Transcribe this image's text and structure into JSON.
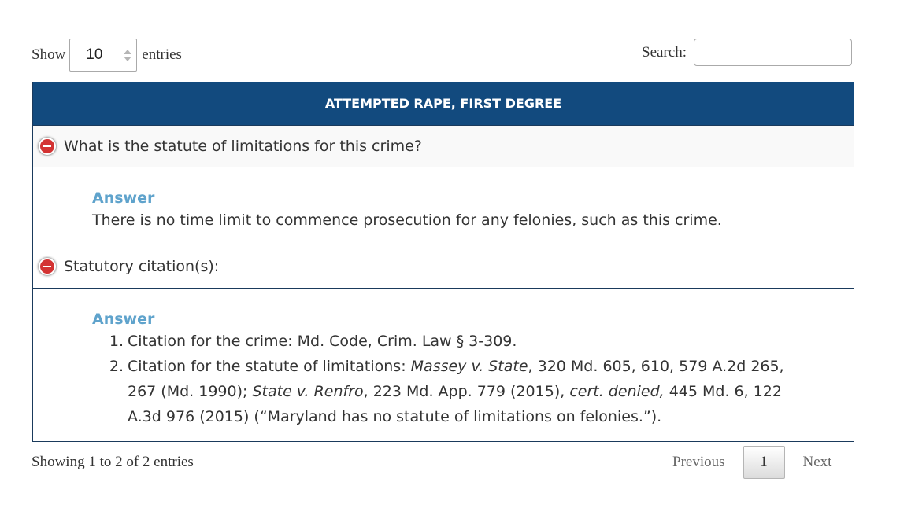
{
  "length_menu": {
    "prefix": "Show",
    "value": "10",
    "suffix": "entries"
  },
  "search": {
    "label": "Search:",
    "value": "",
    "placeholder": ""
  },
  "table": {
    "header": "ATTEMPTED RAPE, FIRST DEGREE",
    "rows": [
      {
        "question": "What is the statute of limitations for this crime?",
        "answer_label": "Answer",
        "answer_text": "There is no time limit to commence prosecution for any felonies, such as this crime."
      },
      {
        "question": "Statutory citation(s):",
        "answer_label": "Answer",
        "citations": [
          {
            "num": "1.",
            "text": "Citation for the crime: Md. Code, Crim. Law § 3-309."
          },
          {
            "num": "2.",
            "t1": "Citation for the statute of limitations: ",
            "i1": "Massey v. State",
            "t2": ", 320 Md. 605, 610, 579 A.2d 265, 267 (Md. 1990); ",
            "i2": "State v. Renfro",
            "t3": ", 223 Md. App. 779 (2015), ",
            "i3": "cert. denied,",
            "t4": " 445 Md. 6, 122 A.3d 976 (2015) (“Maryland has no statute of limitations on felonies.”)."
          }
        ]
      }
    ]
  },
  "footer": {
    "info": "Showing 1 to 2 of 2 entries",
    "previous": "Previous",
    "current_page": "1",
    "next": "Next"
  },
  "colors": {
    "header_bg": "#124a7e",
    "answer_label": "#5fa3cc",
    "control_button": "#d33333"
  },
  "icons": {
    "row_toggle": "minus-circle-icon",
    "select_spinner": "up-down-arrows-icon"
  }
}
